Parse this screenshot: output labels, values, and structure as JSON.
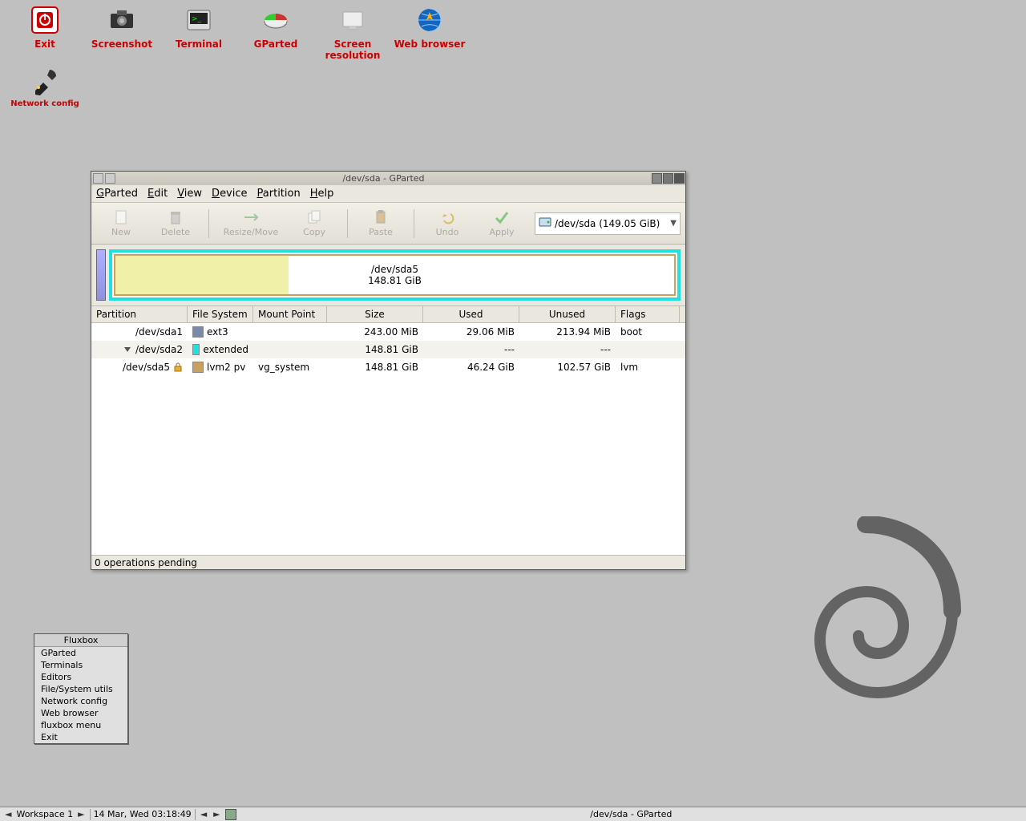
{
  "desktop": {
    "icons": [
      {
        "id": "exit",
        "label": "Exit"
      },
      {
        "id": "screenshot",
        "label": "Screenshot"
      },
      {
        "id": "terminal",
        "label": "Terminal"
      },
      {
        "id": "gparted",
        "label": "GParted"
      },
      {
        "id": "screenres",
        "label": "Screen resolution"
      },
      {
        "id": "webbrowser",
        "label": "Web browser"
      }
    ],
    "row2": {
      "id": "netconfig",
      "label": "Network config"
    }
  },
  "fluxbox_menu": {
    "title": "Fluxbox",
    "items": [
      "GParted",
      "Terminals",
      "Editors",
      "File/System utils",
      "Network config",
      "Web browser",
      "fluxbox menu",
      "Exit"
    ]
  },
  "taskbar": {
    "workspace": "Workspace 1",
    "clock": "14 Mar, Wed 03:18:49",
    "task": "/dev/sda - GParted"
  },
  "gparted": {
    "title": "/dev/sda - GParted",
    "menu": [
      "GParted",
      "Edit",
      "View",
      "Device",
      "Partition",
      "Help"
    ],
    "toolbar": [
      {
        "id": "new",
        "label": "New",
        "disabled": true
      },
      {
        "id": "delete",
        "label": "Delete",
        "disabled": true
      },
      {
        "id": "resize",
        "label": "Resize/Move",
        "disabled": true
      },
      {
        "id": "copy",
        "label": "Copy",
        "disabled": true
      },
      {
        "id": "paste",
        "label": "Paste",
        "disabled": true
      },
      {
        "id": "undo",
        "label": "Undo",
        "disabled": true
      },
      {
        "id": "apply",
        "label": "Apply",
        "disabled": true
      }
    ],
    "device_selector": "/dev/sda  (149.05 GiB)",
    "graph": {
      "label_line1": "/dev/sda5",
      "label_line2": "148.81 GiB"
    },
    "columns": [
      "Partition",
      "File System",
      "Mount Point",
      "Size",
      "Used",
      "Unused",
      "Flags"
    ],
    "rows": [
      {
        "indent": 0,
        "expander": false,
        "name": "/dev/sda1",
        "locked": false,
        "fs": "ext3",
        "fscolor": "#7a8aa8",
        "mount": "",
        "size": "243.00 MiB",
        "used": "29.06 MiB",
        "unused": "213.94 MiB",
        "flags": "boot"
      },
      {
        "indent": 0,
        "expander": true,
        "name": "/dev/sda2",
        "locked": false,
        "fs": "extended",
        "fscolor": "#20e0e0",
        "mount": "",
        "size": "148.81 GiB",
        "used": "---",
        "unused": "---",
        "flags": ""
      },
      {
        "indent": 1,
        "expander": false,
        "name": "/dev/sda5",
        "locked": true,
        "fs": "lvm2 pv",
        "fscolor": "#c8a060",
        "mount": "vg_system",
        "size": "148.81 GiB",
        "used": "46.24 GiB",
        "unused": "102.57 GiB",
        "flags": "lvm"
      }
    ],
    "status": "0 operations pending"
  }
}
